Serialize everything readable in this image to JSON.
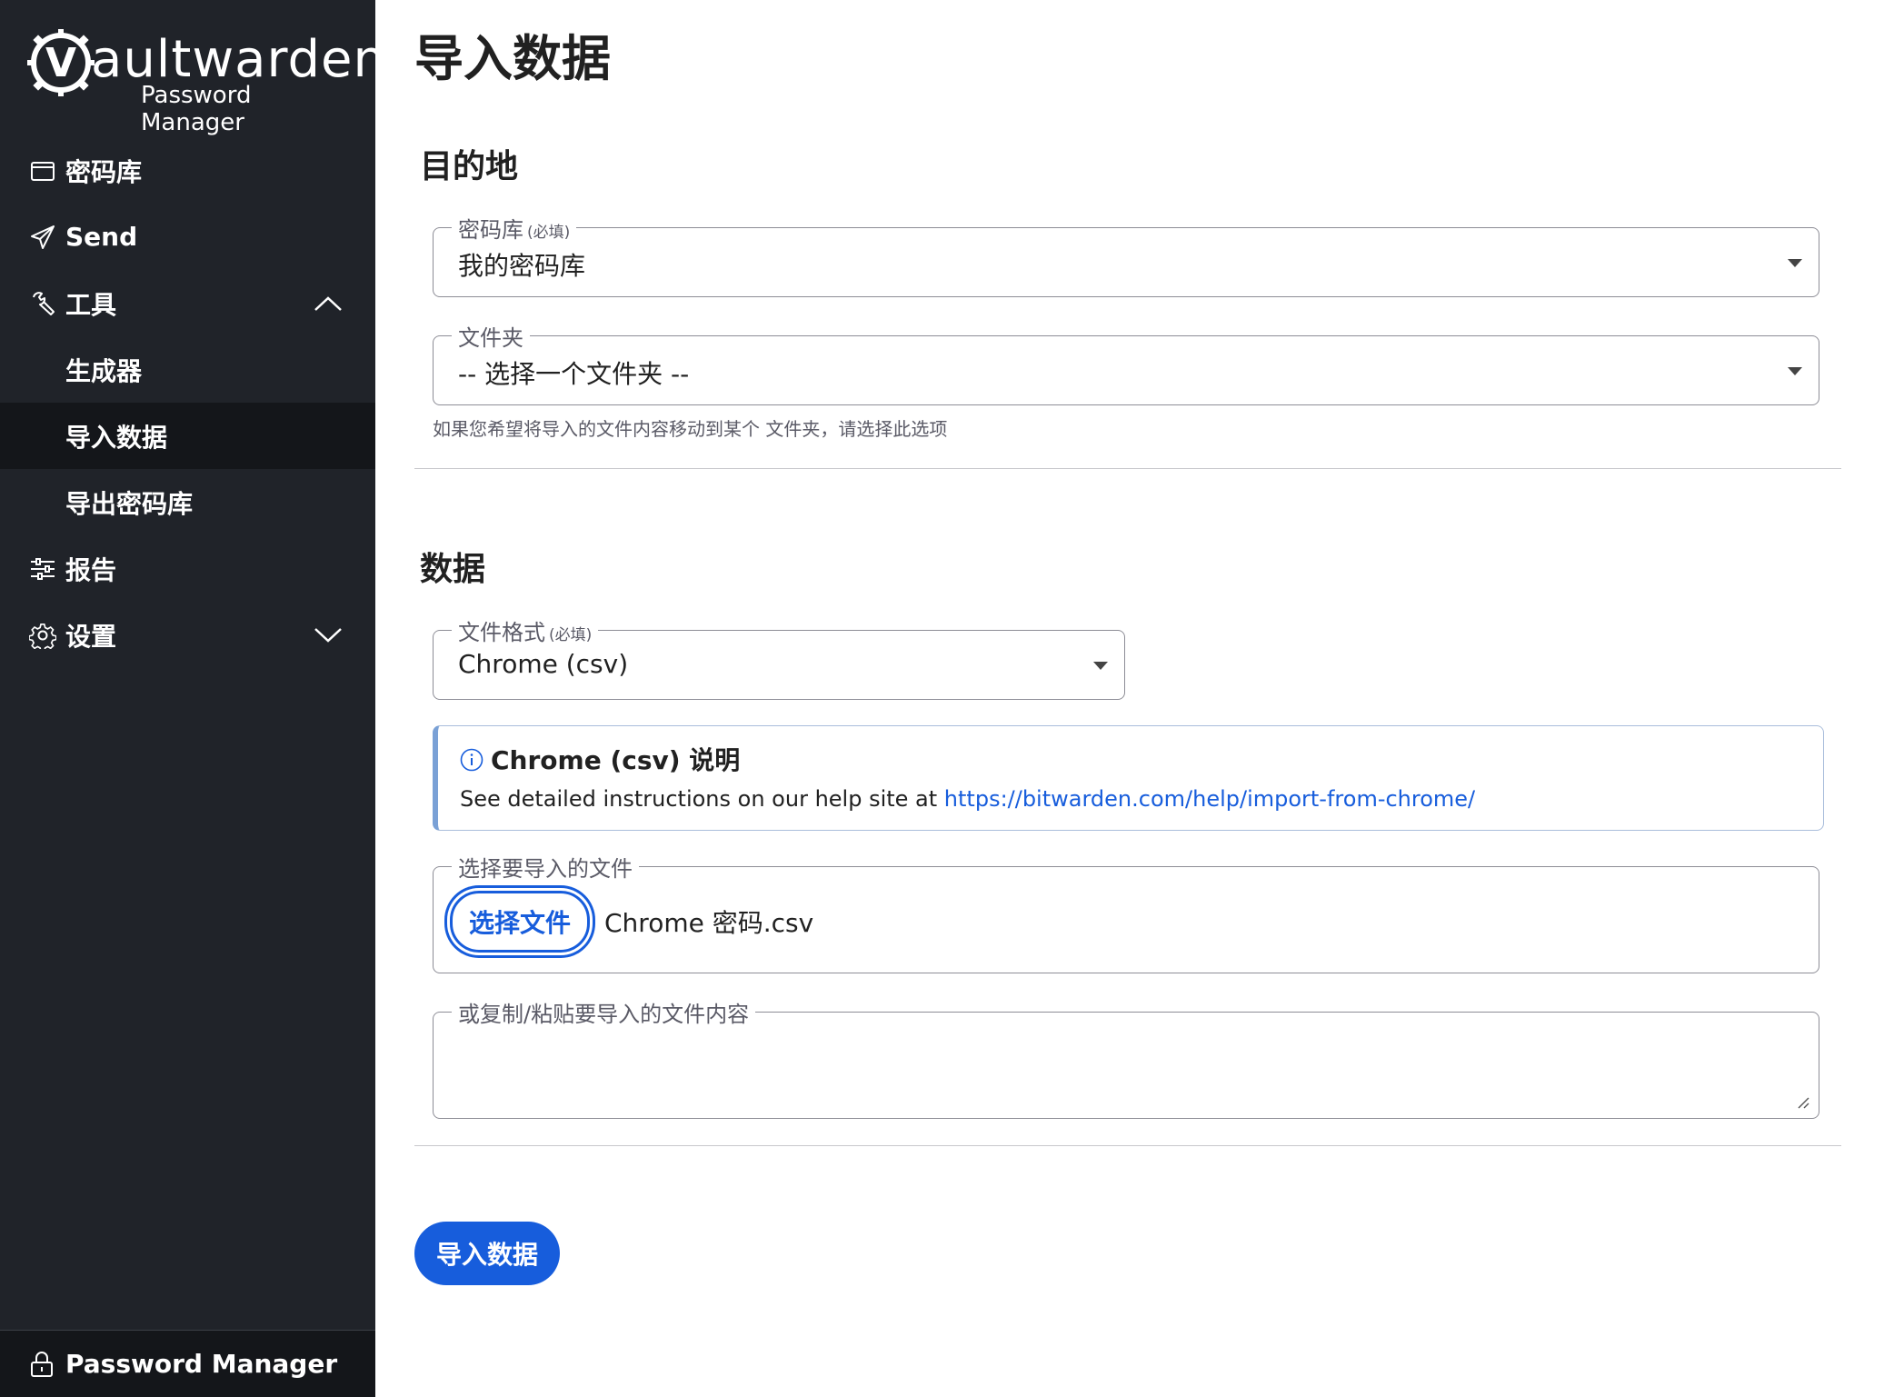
{
  "app": {
    "logo_text_rest": "aultwarden",
    "logo_letter": "V",
    "logo_sub": "Password Manager",
    "accent_color": "#175ddc",
    "sidebar_bg": "#202329"
  },
  "sidebar": {
    "items": [
      {
        "label": "密码库",
        "icon": "vault-icon"
      },
      {
        "label": "Send",
        "icon": "send-icon"
      },
      {
        "label": "工具",
        "icon": "wrench-icon",
        "expanded": true
      },
      {
        "label": "生成器"
      },
      {
        "label": "导入数据",
        "active": true
      },
      {
        "label": "导出密码库"
      },
      {
        "label": "报告",
        "icon": "sliders-icon"
      },
      {
        "label": "设置",
        "icon": "gear-icon",
        "expanded": false
      }
    ],
    "footer": {
      "label": "Password Manager",
      "icon": "lock-icon"
    }
  },
  "main": {
    "title": "导入数据",
    "destination": {
      "heading": "目的地",
      "vault_label": "密码库",
      "vault_required": "(必填)",
      "vault_value": "我的密码库",
      "folder_label": "文件夹",
      "folder_value": "-- 选择一个文件夹 --",
      "folder_hint": "如果您希望将导入的文件内容移动到某个 文件夹，请选择此选项"
    },
    "data": {
      "heading": "数据",
      "format_label": "文件格式",
      "format_required": "(必填)",
      "format_value": "Chrome (csv)",
      "info_title": "Chrome (csv) 说明",
      "info_text": "See detailed instructions on our help site at ",
      "info_link": "https://bitwarden.com/help/import-from-chrome/",
      "file_label": "选择要导入的文件",
      "file_button": "选择文件",
      "file_name": "Chrome 密码.csv",
      "paste_label": "或复制/粘贴要导入的文件内容",
      "paste_value": ""
    },
    "submit_label": "导入数据"
  }
}
